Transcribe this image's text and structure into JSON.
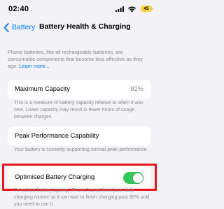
{
  "status_bar": {
    "time": "02:40",
    "battery_level": "45",
    "battery_color": "#fbd53f",
    "icons": [
      "signal-icon",
      "wifi-icon",
      "battery-icon"
    ]
  },
  "nav": {
    "back_label": "Battery",
    "title": "Battery Health & Charging",
    "accent_color": "#007aff"
  },
  "intro": {
    "text": "Phone batteries, like all rechargeable batteries, are consumable components that become less effective as they age.",
    "link": "Learn more..."
  },
  "maximum_capacity": {
    "label": "Maximum Capacity",
    "value": "92%",
    "footnote": "This is a measure of battery capacity relative to when it was new. Lower capacity may result in fewer hours of usage between charges."
  },
  "peak_performance": {
    "label": "Peak Performance Capability",
    "footnote": "Your battery is currently supporting normal peak performance."
  },
  "optimised_charging": {
    "label": "Optimised Battery Charging",
    "enabled": true,
    "toggle_color": "#34c759",
    "highlight_color": "#e8141e",
    "footnote": "To reduce battery ageing, iPhone learns from your daily charging routine so it can wait to finish charging past 80% until you need to use it."
  }
}
